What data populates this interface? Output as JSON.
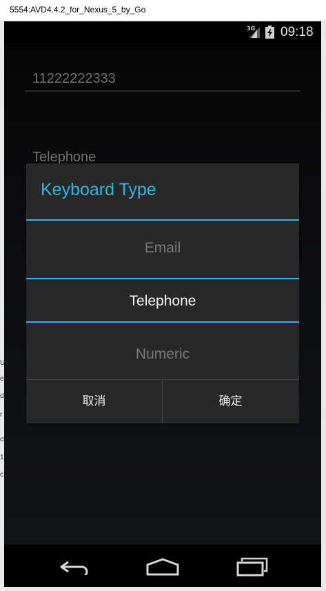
{
  "window": {
    "title": "5554:AVD4.4.2_for_Nexus_5_by_Go"
  },
  "left_edge_fragments": [
    "U",
    "e",
    "d",
    "r",
    "cl",
    "1",
    "c"
  ],
  "status_bar": {
    "network": "3G",
    "time": "09:18"
  },
  "background": {
    "field_value": "11222222333",
    "label": "Telephone"
  },
  "dialog": {
    "title": "Keyboard Type",
    "options": [
      {
        "label": "Email",
        "selected": false
      },
      {
        "label": "Telephone",
        "selected": true
      },
      {
        "label": "Numeric",
        "selected": false
      }
    ],
    "cancel_label": "取消",
    "ok_label": "确定"
  },
  "colors": {
    "accent": "#33b5e5",
    "dialog_bg": "#282828"
  },
  "nav_bar": {
    "icons": [
      "back-icon",
      "home-icon",
      "recent-apps-icon"
    ]
  }
}
